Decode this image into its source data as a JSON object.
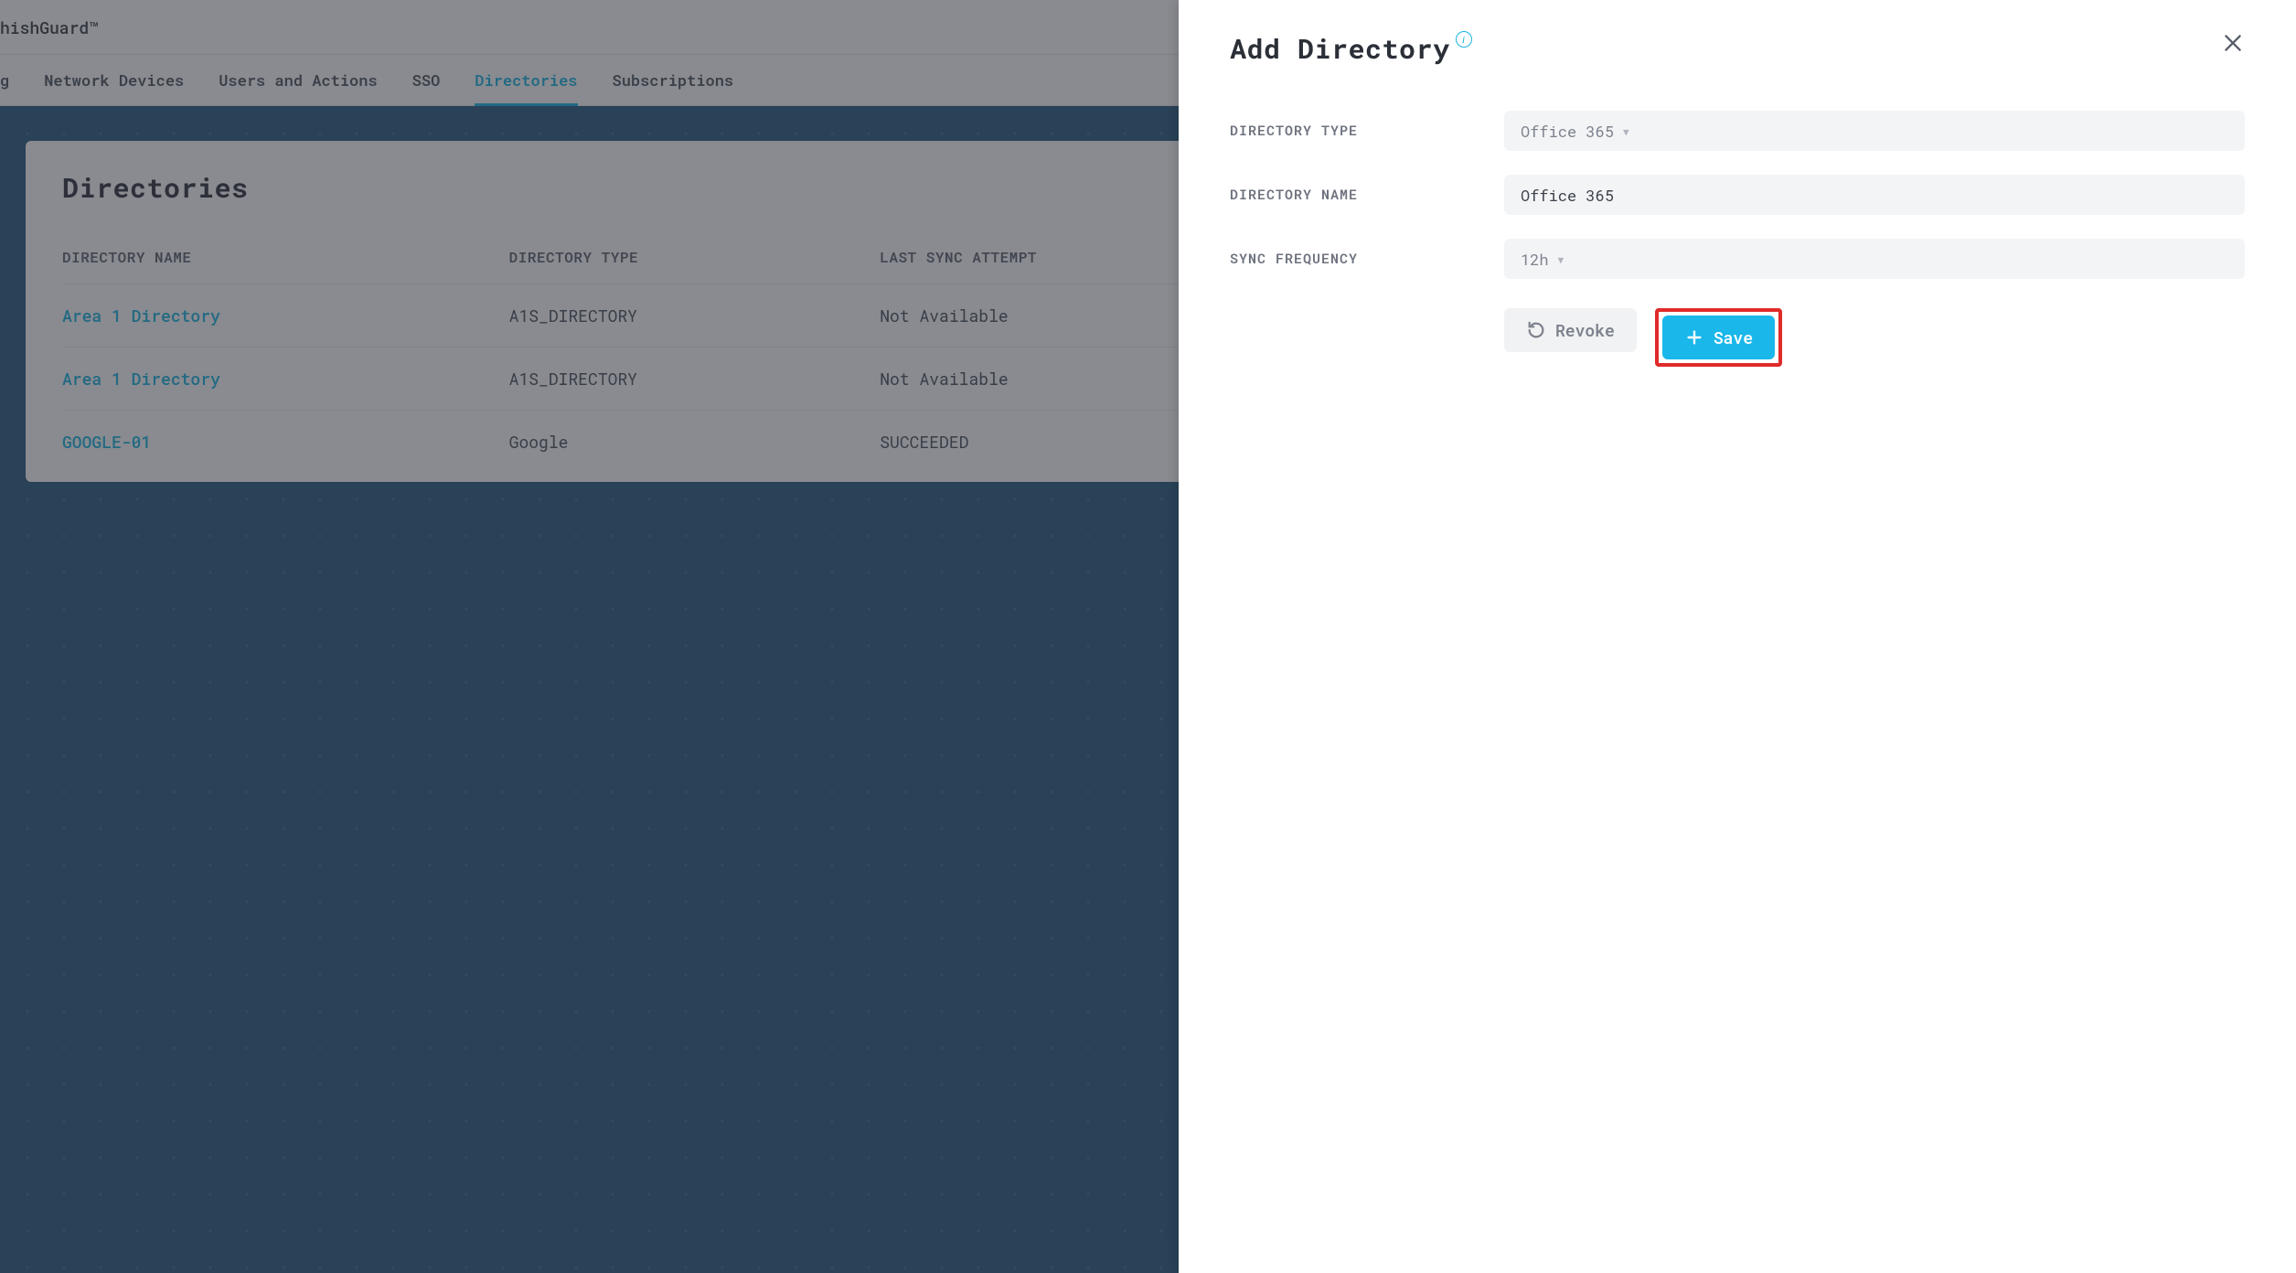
{
  "brand": "hishGuard™",
  "nav": {
    "items": [
      {
        "label": "g",
        "partial": true
      },
      {
        "label": "Network Devices"
      },
      {
        "label": "Users and Actions"
      },
      {
        "label": "SSO"
      },
      {
        "label": "Directories",
        "active": true
      },
      {
        "label": "Subscriptions"
      }
    ]
  },
  "page": {
    "title": "Directories",
    "columns": {
      "name": "DIRECTORY NAME",
      "type": "DIRECTORY TYPE",
      "sync": "LAST SYNC ATTEMPT"
    },
    "rows": [
      {
        "name": "Area 1 Directory",
        "type": "A1S_DIRECTORY",
        "sync": "Not Available"
      },
      {
        "name": "Area 1 Directory",
        "type": "A1S_DIRECTORY",
        "sync": "Not Available"
      },
      {
        "name": "GOOGLE-01",
        "type": "Google",
        "sync": "SUCCEEDED"
      }
    ]
  },
  "panel": {
    "title": "Add Directory",
    "fields": {
      "type": {
        "label": "DIRECTORY TYPE",
        "value": "Office 365"
      },
      "name": {
        "label": "DIRECTORY NAME",
        "value": "Office 365"
      },
      "freq": {
        "label": "SYNC FREQUENCY",
        "value": "12h"
      }
    },
    "actions": {
      "revoke": "Revoke",
      "save": "Save"
    }
  }
}
